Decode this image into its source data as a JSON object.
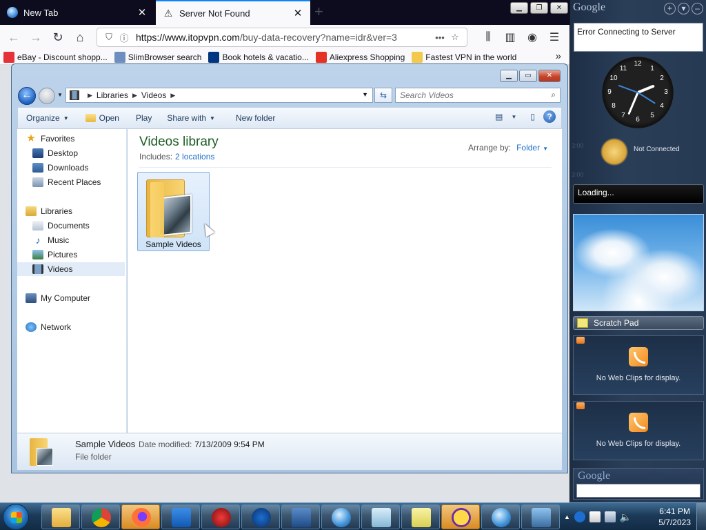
{
  "browser": {
    "tabs": [
      {
        "title": "New Tab",
        "active": false
      },
      {
        "title": "Server Not Found",
        "active": true
      }
    ],
    "url": {
      "host": "https://www.itopvpn.com",
      "path": "/buy-data-recovery?name=idr&ver=3"
    },
    "bookmarks": [
      {
        "label": "eBay - Discount shopp...",
        "color": "#e53238"
      },
      {
        "label": "SlimBrowser search",
        "color": "#6c8fbf"
      },
      {
        "label": "Book hotels & vacatio...",
        "color": "#003580"
      },
      {
        "label": "Aliexpress Shopping",
        "color": "#e43225"
      },
      {
        "label": "Fastest VPN in the world",
        "color": "#f2c94c"
      }
    ]
  },
  "explorer": {
    "breadcrumb": [
      "Libraries",
      "Videos"
    ],
    "search_placeholder": "Search Videos",
    "toolbar": {
      "organize": "Organize",
      "open": "Open",
      "play": "Play",
      "share_with": "Share with",
      "new_folder": "New folder"
    },
    "nav": {
      "favorites": "Favorites",
      "favorites_items": [
        "Desktop",
        "Downloads",
        "Recent Places"
      ],
      "libraries": "Libraries",
      "libraries_items": [
        "Documents",
        "Music",
        "Pictures",
        "Videos"
      ],
      "computer": "My Computer",
      "network": "Network"
    },
    "library_title": "Videos library",
    "includes_label": "Includes:",
    "includes_link": "2 locations",
    "arrange_label": "Arrange by:",
    "arrange_value": "Folder",
    "items": [
      {
        "name": "Sample Videos"
      }
    ],
    "details": {
      "name": "Sample Videos",
      "modified_label": "Date modified:",
      "modified_value": "7/13/2009 9:54 PM",
      "type": "File folder"
    }
  },
  "sidebar": {
    "logo": "Google",
    "error_text": "Error Connecting to Server",
    "clock_numbers": [
      "12",
      "1",
      "2",
      "3",
      "4",
      "5",
      "6",
      "7",
      "8",
      "9",
      "10",
      "11"
    ],
    "weather_status": "Not Connected",
    "ghost_times": [
      "3:00",
      "3:00"
    ],
    "loading_text": "Loading...",
    "scratch_title": "Scratch Pad",
    "webclips": [
      "No Web Clips for display.",
      "No Web Clips for display."
    ],
    "search_logo": "Google"
  },
  "taskbar": {
    "time": "6:41 PM",
    "date": "5/7/2023"
  }
}
